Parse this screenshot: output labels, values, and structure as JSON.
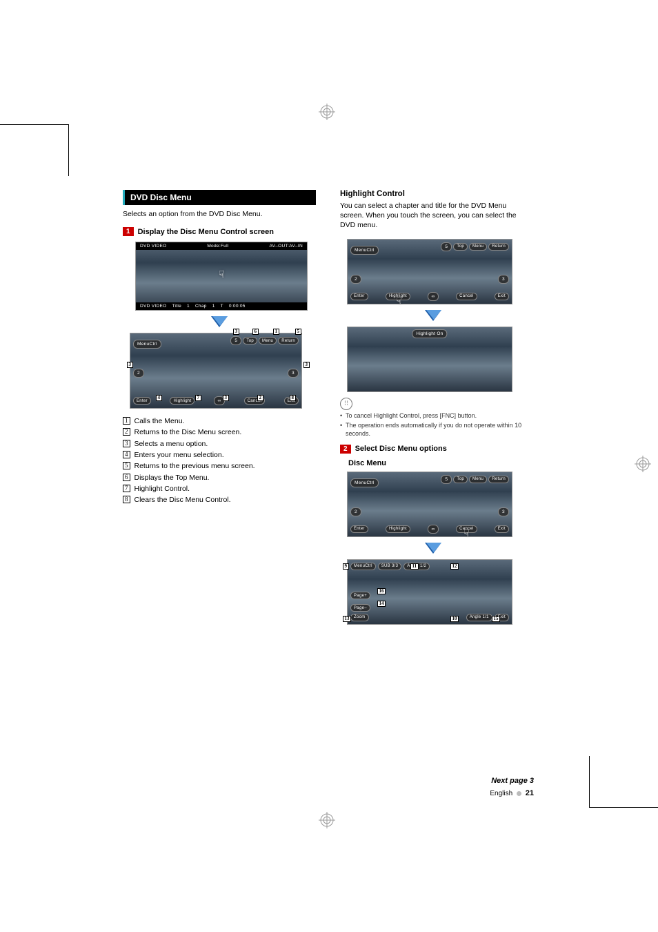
{
  "left": {
    "header": "DVD Disc Menu",
    "intro": "Selects an option from the DVD Disc Menu.",
    "step1_num": "1",
    "step1_text": "Display the Disc Menu Control screen",
    "playback": {
      "top_left": "DVD VIDEO",
      "top_mid": "Mode:Full",
      "top_right": "AV–OUT:AV–IN",
      "bot_source": "DVD VIDEO",
      "bot_title_label": "Title",
      "bot_title_val": "1",
      "bot_chap_label": "Chap",
      "bot_chap_val": "1",
      "bot_t_label": "T",
      "bot_time": "0:00:05"
    },
    "menu": {
      "top_left": "MenuCtrl",
      "up": "5",
      "top": "Top",
      "menu": "Menu",
      "return": "Return",
      "left": "2",
      "right": "3",
      "enter": "Enter",
      "highlight": "Highlight",
      "down": "∞",
      "cancel": "Cancel",
      "exit": "Exit"
    },
    "callouts": {
      "c1": "1",
      "c2": "2",
      "c3": "3",
      "c4": "4",
      "c5": "5",
      "c6": "6",
      "c7": "7",
      "c8": "8"
    },
    "list": [
      "Calls the Menu.",
      "Returns to the Disc Menu screen.",
      "Selects a menu option.",
      "Enters your menu selection.",
      "Returns to the previous menu screen.",
      "Displays the Top Menu.",
      "Highlight Control.",
      "Clears the Disc Menu Control."
    ]
  },
  "right": {
    "hc_head": "Highlight Control",
    "hc_body": "You can select a chapter and title for the DVD Menu screen. When you touch the screen, you can select the DVD menu.",
    "screen1": {
      "top_left": "MenuCtrl",
      "up": "5",
      "top": "Top",
      "menu": "Menu",
      "return": "Return",
      "left": "2",
      "right": "3",
      "enter": "Enter",
      "highlight": "Highlight",
      "down": "∞",
      "cancel": "Cancel",
      "exit": "Exit"
    },
    "hl_on": "Highlight On",
    "notes": [
      "To cancel Highlight Control, press [FNC] button.",
      "The operation ends automatically if you do not operate within 10 seconds."
    ],
    "step2_num": "2",
    "step2_text": "Select Disc Menu options",
    "disc_menu_label": "Disc Menu",
    "screen3": {
      "top_left": "MenuCtrl",
      "up": "5",
      "top": "Top",
      "menu": "Menu",
      "return": "Return",
      "left": "2",
      "right": "3",
      "enter": "Enter",
      "highlight": "Highlight",
      "down": "∞",
      "cancel": "Cancel",
      "exit": "Exit"
    },
    "screen4": {
      "menuctrl": "MenuCtrl",
      "sub_label": "SUB",
      "sub_val": "3/3",
      "audio_label": "Audio",
      "audio_val": "1/2",
      "page_plus": "Page+",
      "page_minus": "Page–",
      "zoom": "Zoom",
      "angle_label": "Angle",
      "angle_val": "1/1",
      "exit": "Exit"
    },
    "callouts4": {
      "c9": "9",
      "c10": "10",
      "c11": "11",
      "c12": "12",
      "c13": "13",
      "c14": "14",
      "c15": "15",
      "c16": "16"
    }
  },
  "footer": {
    "next_page": "Next page ",
    "next_arrow": "3",
    "lang": "English",
    "page_no": "21"
  }
}
